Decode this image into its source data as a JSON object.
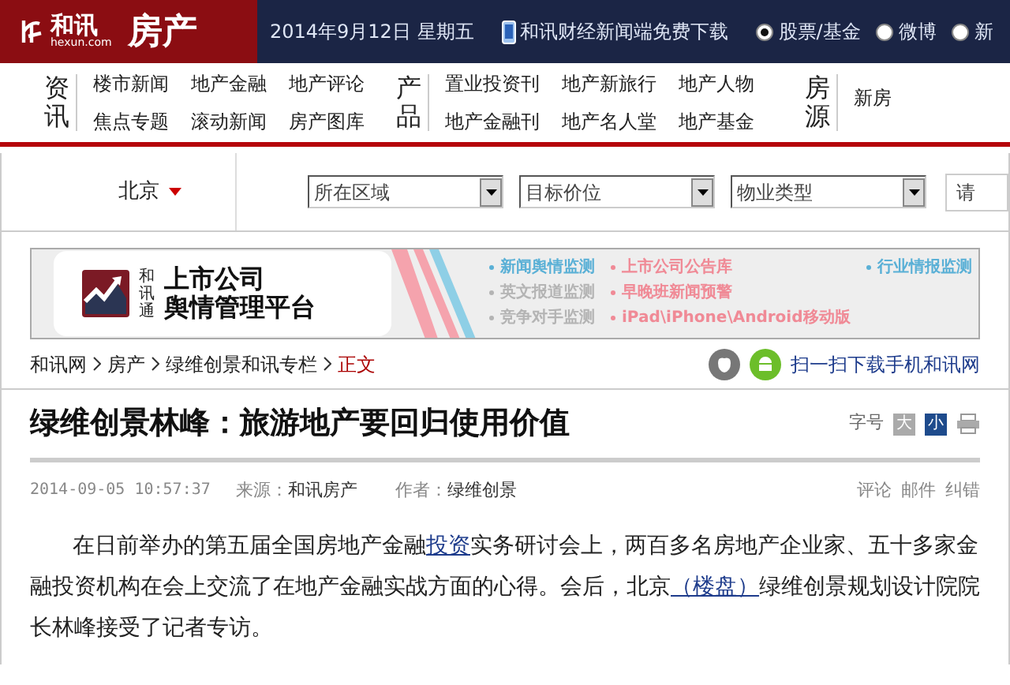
{
  "header": {
    "logo_brand": "和讯",
    "logo_domain": "hexun.com",
    "logo_section": "房产",
    "date": "2014年9月12日  星期五",
    "download": "和讯财经新闻端免费下载",
    "search_scope": [
      {
        "label": "股票/基金",
        "selected": true
      },
      {
        "label": "微博",
        "selected": false
      },
      {
        "label": "新",
        "selected": false
      }
    ]
  },
  "nav": [
    {
      "heading": "资讯",
      "links": [
        "楼市新闻",
        "地产金融",
        "地产评论",
        "焦点专题",
        "滚动新闻",
        "房产图库"
      ]
    },
    {
      "heading": "产品",
      "links": [
        "置业投资刊",
        "地产新旅行",
        "地产人物",
        "地产金融刊",
        "地产名人堂",
        "地产基金"
      ]
    },
    {
      "heading": "房源",
      "links": [
        "新房"
      ]
    }
  ],
  "filters": {
    "city": "北京",
    "dropdowns": [
      "所在区域",
      "目标价位",
      "物业类型"
    ],
    "search_placeholder": "请"
  },
  "banner": {
    "brand": "和讯通",
    "title_line1": "上市公司",
    "title_line2": "舆情管理平台",
    "items": [
      {
        "label": "新闻舆情监测",
        "color": "#5ab0d6"
      },
      {
        "label": "英文报道监测",
        "color": "#b4b4b4"
      },
      {
        "label": "竞争对手监测",
        "color": "#b4b4b4"
      },
      {
        "label": "上市公司公告库",
        "color": "#f08a96"
      },
      {
        "label": "早晚班新闻预警",
        "color": "#f08a96"
      },
      {
        "label": "iPad\\iPhone\\Android移动版",
        "color": "#f08a96"
      },
      {
        "label": "行业情报监测",
        "color": "#5ab0d6"
      }
    ]
  },
  "breadcrumb": [
    {
      "label": "和讯网",
      "current": false
    },
    {
      "label": "房产",
      "current": false
    },
    {
      "label": "绿维创景和讯专栏",
      "current": false
    },
    {
      "label": "正文",
      "current": true
    }
  ],
  "app_download": "扫一扫下载手机和讯网",
  "article": {
    "title": "绿维创景林峰：旅游地产要回归使用价值",
    "font_size_label": "字号",
    "font_sizes": [
      {
        "label": "大",
        "selected": false
      },
      {
        "label": "小",
        "selected": true
      }
    ],
    "datetime": "2014-09-05 10:57:37",
    "source_label": "来源：",
    "source": "和讯房产",
    "author_label": "作者：",
    "author": "绿维创景",
    "actions": [
      "评论",
      "邮件",
      "纠错"
    ],
    "paragraph": [
      {
        "kind": "text",
        "text": "在日前举办的第五届全国房地产金融"
      },
      {
        "kind": "link",
        "text": "投资"
      },
      {
        "kind": "text",
        "text": "实务研讨会上，两百多名房地产企业家、五十多家金融投资机构在会上交流了在地产金融实战方面的心得。会后，北京"
      },
      {
        "kind": "link",
        "text": "（楼盘）"
      },
      {
        "kind": "text",
        "text": "绿维创景规划设计院院长林峰接受了记者专访。"
      }
    ]
  }
}
